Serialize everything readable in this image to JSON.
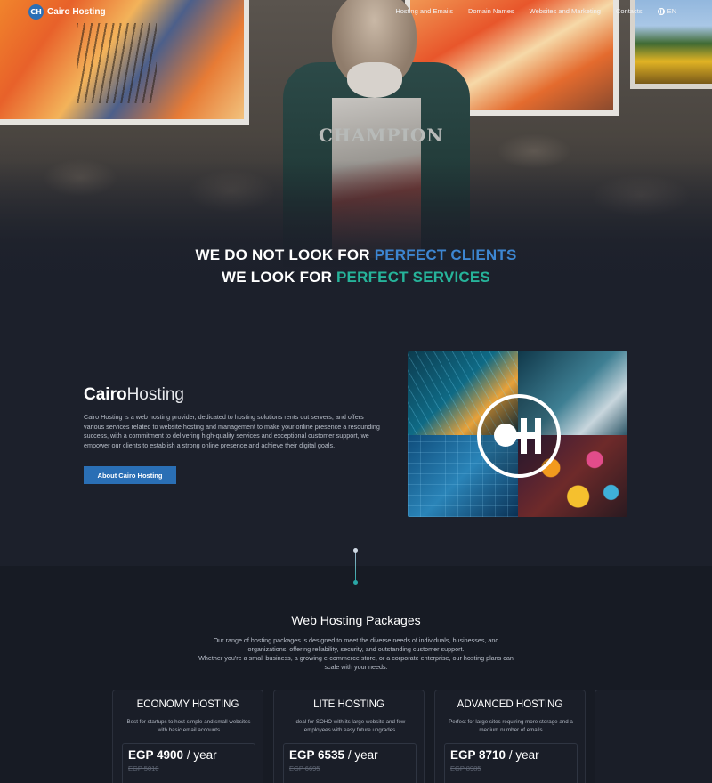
{
  "nav": {
    "logo_mark": "CH",
    "logo_text": "Cairo Hosting",
    "items": [
      {
        "label": "Hosting and Emails"
      },
      {
        "label": "Domain Names"
      },
      {
        "label": "Websites and Marketing"
      },
      {
        "label": "Contacts"
      }
    ],
    "lang": "EN"
  },
  "hero": {
    "shirt_text": "CHAMPION",
    "line1_white": "WE DO NOT LOOK FOR",
    "line1_accent": "PERFECT CLIENTS",
    "line2_white": "WE LOOK FOR",
    "line2_accent": "PERFECT SERVICES",
    "accent_blue": "#3d86d1",
    "accent_teal": "#26b39a"
  },
  "about": {
    "title_bold": "Cairo",
    "title_light": "Hosting",
    "text": "Cairo Hosting is a web hosting provider, dedicated to hosting solutions rents out servers, and offers various services related to website hosting and management to make your online presence a resounding success, with a commitment to delivering high-quality services and exceptional customer support, we empower our clients to establish a strong online presence and achieve their digital goals.",
    "button_label": "About Cairo Hosting"
  },
  "packages": {
    "title": "Web Hosting Packages",
    "description_1": "Our range of hosting packages is designed to meet the diverse needs of individuals, businesses, and organizations, offering reliability, security, and outstanding customer support.",
    "description_2": "Whether you're a small business, a growing e-commerce store, or a corporate enterprise, our hosting plans can scale with your needs.",
    "cards": [
      {
        "name": "ECONOMY HOSTING",
        "subtitle": "Best for startups to host simple and small websites with basic email accounts",
        "price": "EGP 4900",
        "period": "/ year",
        "old_price": "EGP 5010"
      },
      {
        "name": "LITE HOSTING",
        "subtitle": "Ideal for SOHO with its large website and few employees with easy future upgrades",
        "price": "EGP 6535",
        "period": "/ year",
        "old_price": "EGP 6695"
      },
      {
        "name": "ADVANCED HOSTING",
        "subtitle": "Perfect for large sites requiring more storage and a medium number of emails",
        "price": "EGP 8710",
        "period": "/ year",
        "old_price": "EGP 8985"
      }
    ]
  },
  "colors": {
    "background": "#1c202b",
    "button": "#2a6fb5"
  }
}
